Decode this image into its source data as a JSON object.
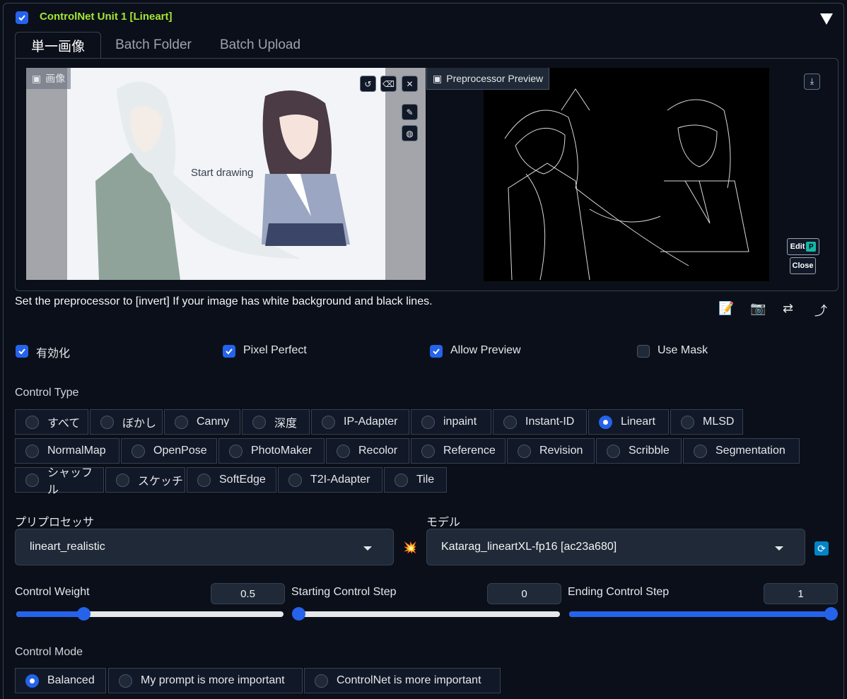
{
  "unit": {
    "title": "ControlNet Unit 1  [Lineart]",
    "enabled": true
  },
  "tabs": [
    {
      "label": "単一画像",
      "active": true
    },
    {
      "label": "Batch Folder",
      "active": false
    },
    {
      "label": "Batch Upload",
      "active": false
    }
  ],
  "image_panel": {
    "label": "画像",
    "canvas_text": "Start drawing"
  },
  "preview_panel": {
    "label": "Preprocessor Preview",
    "edit_label": "Edit",
    "close_label": "Close"
  },
  "hint": "Set the preprocessor to [invert] If your image has white background and black lines.",
  "tools": [
    "📝",
    "📷",
    "⇄",
    "⤴"
  ],
  "options": [
    {
      "label": "有効化",
      "checked": true
    },
    {
      "label": "Pixel Perfect",
      "checked": true
    },
    {
      "label": "Allow Preview",
      "checked": true
    },
    {
      "label": "Use Mask",
      "checked": false
    }
  ],
  "control_type": {
    "label": "Control Type",
    "selected": "Lineart",
    "rows": [
      [
        "すべて",
        "ぼかし",
        "Canny",
        "深度",
        "IP-Adapter",
        "inpaint",
        "Instant-ID",
        "Lineart",
        "MLSD"
      ],
      [
        "NormalMap",
        "OpenPose",
        "PhotoMaker",
        "Recolor",
        "Reference",
        "Revision",
        "Scribble",
        "Segmentation"
      ],
      [
        "シャッフル",
        "スケッチ",
        "SoftEdge",
        "T2I-Adapter",
        "Tile"
      ]
    ]
  },
  "preprocessor": {
    "label": "プリプロセッサ",
    "value": "lineart_realistic",
    "run_icon": "💥"
  },
  "model": {
    "label": "モデル",
    "value": "Katarag_lineartXL-fp16 [ac23a680]"
  },
  "sliders": [
    {
      "label": "Control Weight",
      "value": "0.5",
      "fraction": 0.25
    },
    {
      "label": "Starting Control Step",
      "value": "0",
      "fraction": 0.0
    },
    {
      "label": "Ending Control Step",
      "value": "1",
      "fraction": 1.0
    }
  ],
  "control_mode": {
    "label": "Control Mode",
    "selected": "Balanced",
    "options": [
      "Balanced",
      "My prompt is more important",
      "ControlNet is more important"
    ]
  },
  "colors": {
    "accent": "#2563eb",
    "title": "#a3e635",
    "background": "#0b0f19"
  }
}
